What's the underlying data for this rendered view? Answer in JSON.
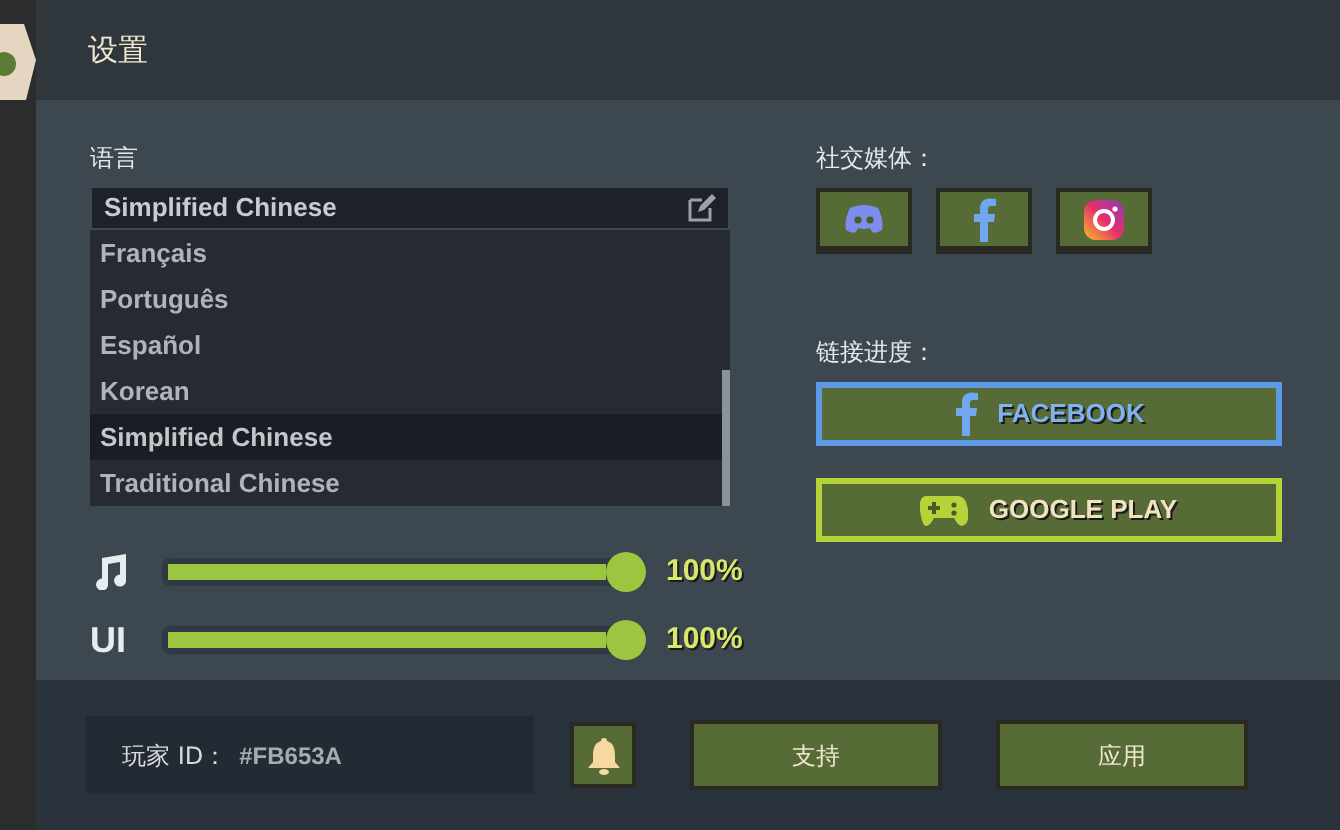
{
  "window": {
    "title": "设置"
  },
  "language": {
    "label": "语言",
    "current": "Simplified Chinese",
    "options": [
      {
        "label": "Français",
        "selected": false
      },
      {
        "label": "Português",
        "selected": false
      },
      {
        "label": "Español",
        "selected": false
      },
      {
        "label": "Korean",
        "selected": false
      },
      {
        "label": "Simplified Chinese",
        "selected": true
      },
      {
        "label": "Traditional Chinese",
        "selected": false
      }
    ]
  },
  "volumes": [
    {
      "kind": "music",
      "level": 1,
      "reading": "100%"
    },
    {
      "kind": "text",
      "label": "UI",
      "level": 1,
      "reading": "100%"
    }
  ],
  "social": {
    "label": "社交媒体：",
    "buttons": [
      {
        "kind": "discord"
      },
      {
        "kind": "facebook"
      },
      {
        "kind": "instagram"
      }
    ]
  },
  "link_progress": {
    "label": "链接进度：",
    "buttons": [
      {
        "kind": "facebook",
        "label": "FACEBOOK"
      },
      {
        "kind": "google-play",
        "label": "GOOGLE PLAY"
      }
    ]
  },
  "footer": {
    "player_id_label": "玩家 ID：",
    "player_id": "#FB653A",
    "buttons": [
      {
        "kind": "bell"
      },
      {
        "kind": "text",
        "label": "支持"
      },
      {
        "kind": "text",
        "label": "应用"
      }
    ]
  }
}
